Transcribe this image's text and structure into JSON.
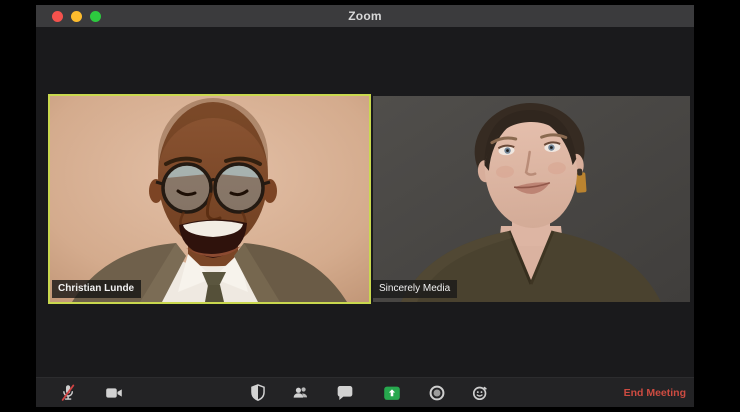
{
  "window": {
    "title": "Zoom",
    "traffic_lights": [
      "close",
      "minimize",
      "zoom"
    ]
  },
  "tiles": [
    {
      "name": "Christian Lunde",
      "active_speaker": true
    },
    {
      "name": "Sincerely Media",
      "active_speaker": false
    }
  ],
  "toolbar": {
    "icons": [
      "microphone-muted",
      "video-camera",
      "security-shield",
      "participants",
      "chat-bubble",
      "share-screen",
      "record",
      "reactions"
    ],
    "end_meeting_label": "End Meeting"
  },
  "colors": {
    "active_speaker_border": "#c9d84e",
    "share_screen_green": "#27a84e",
    "end_meeting_red": "#cd4b41",
    "muted_mic_slash_red": "#d04343",
    "traffic_red": "#f4524d",
    "traffic_yellow": "#fdbc2e",
    "traffic_green": "#2dc93f",
    "titlebar_gray": "#3b3b3d",
    "window_background": "#1a1a1c"
  }
}
